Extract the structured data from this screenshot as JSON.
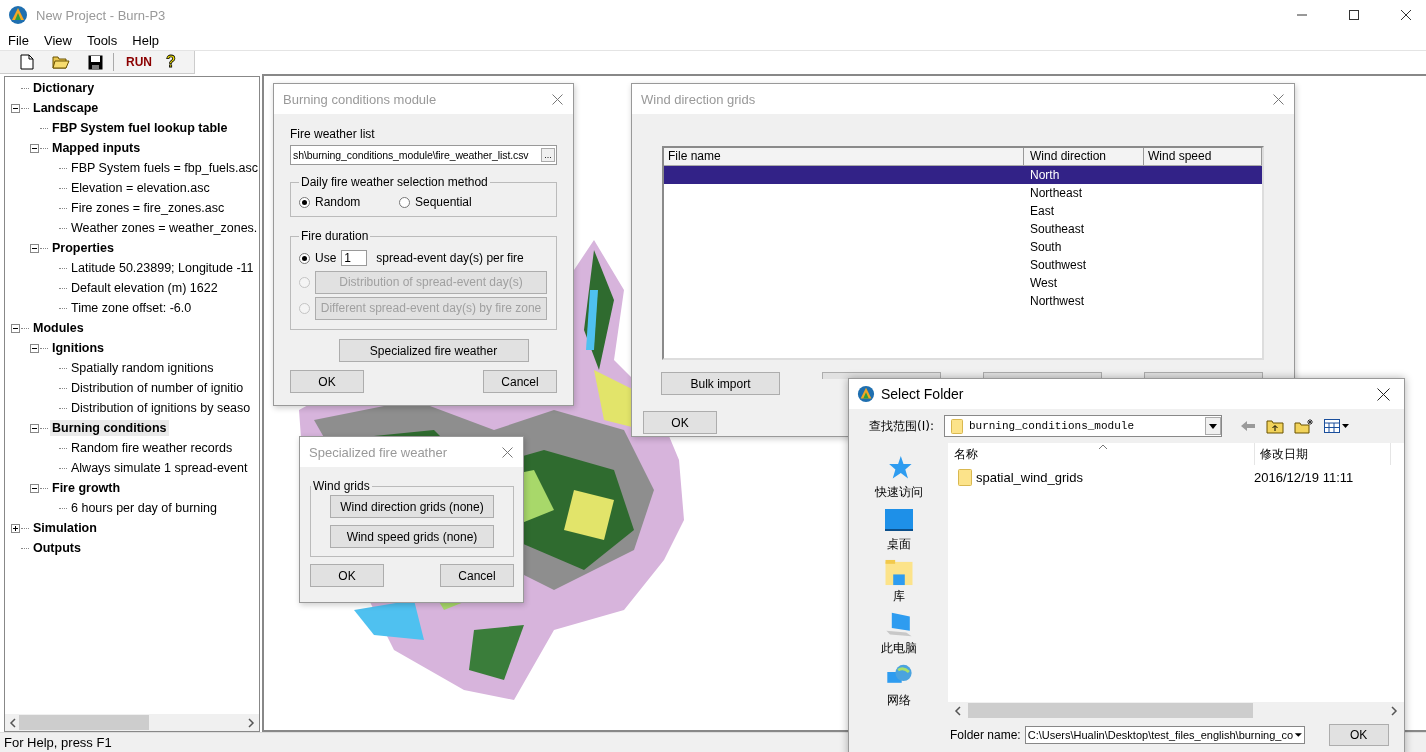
{
  "window": {
    "title": "New Project - Burn-P3"
  },
  "menu": [
    "File",
    "View",
    "Tools",
    "Help"
  ],
  "toolbar": [
    {
      "kind": "new"
    },
    {
      "kind": "open"
    },
    {
      "kind": "save"
    },
    {
      "kind": "run",
      "label": "RUN"
    },
    {
      "kind": "help",
      "label": "?"
    }
  ],
  "tree": [
    {
      "label": "Dictionary",
      "selected": false
    },
    {
      "label": "Landscape",
      "selected": false,
      "expanded": true,
      "children": [
        {
          "label": "FBP System fuel lookup table",
          "selected": false
        },
        {
          "label": "Mapped inputs",
          "selected": false,
          "expanded": true,
          "children": [
            {
              "label": "FBP System fuels = fbp_fuels.asc",
              "selected": false
            },
            {
              "label": "Elevation = elevation.asc",
              "selected": false
            },
            {
              "label": "Fire zones = fire_zones.asc",
              "selected": false
            },
            {
              "label": "Weather zones = weather_zones.",
              "selected": false
            }
          ]
        },
        {
          "label": "Properties",
          "selected": false,
          "expanded": true,
          "children": [
            {
              "label": "Latitude 50.23899; Longitude -11",
              "selected": false
            },
            {
              "label": "Default elevation (m) 1622",
              "selected": false
            },
            {
              "label": "Time zone offset: -6.0",
              "selected": false
            }
          ]
        }
      ]
    },
    {
      "label": "Modules",
      "selected": false,
      "expanded": true,
      "children": [
        {
          "label": "Ignitions",
          "selected": false,
          "expanded": true,
          "children": [
            {
              "label": "Spatially random ignitions",
              "selected": false
            },
            {
              "label": "Distribution of number of ignitio",
              "selected": false
            },
            {
              "label": "Distribution of ignitions by seaso",
              "selected": false
            }
          ]
        },
        {
          "label": "Burning conditions",
          "selected": true,
          "expanded": true,
          "children": [
            {
              "label": "Random fire weather records",
              "selected": false
            },
            {
              "label": "Always simulate 1 spread-event",
              "selected": false
            }
          ]
        },
        {
          "label": "Fire growth",
          "selected": false,
          "expanded": true,
          "children": [
            {
              "label": "6 hours per day of burning",
              "selected": false
            }
          ]
        }
      ]
    },
    {
      "label": "Simulation",
      "selected": false,
      "expanded": false
    },
    {
      "label": "Outputs",
      "selected": false
    }
  ],
  "map": {
    "kind": "picture"
  },
  "burning_dialog": {
    "title": "Burning conditions module",
    "fire_weather_list": {
      "label": "Fire weather list",
      "value": "sh\\burning_conditions_module\\fire_weather_list.csv",
      "button": "..."
    },
    "selection_method": {
      "label": "Daily fire weather selection method",
      "options": [
        {
          "label": "Random",
          "selected": true
        },
        {
          "label": "Sequential",
          "selected": false
        }
      ]
    },
    "fire_duration": {
      "label": "Fire duration",
      "options": [
        {
          "kind": "days",
          "prefix": "Use",
          "value": "1",
          "suffix": "spread-event day(s) per fire",
          "selected": true,
          "disabled": false
        },
        {
          "kind": "button",
          "label": "Distribution of spread-event day(s)",
          "selected": false,
          "disabled": true
        },
        {
          "kind": "button",
          "label": "Different spread-event day(s) by fire zone",
          "selected": false,
          "disabled": true
        }
      ]
    },
    "specialized_button": "Specialized fire weather",
    "ok": "OK",
    "cancel": "Cancel"
  },
  "wind_dialog": {
    "title": "Wind direction grids",
    "columns": [
      "File name",
      "Wind direction",
      "Wind speed"
    ],
    "rows": [
      {
        "wind_direction": "North",
        "selected": true
      },
      {
        "wind_direction": "Northeast",
        "selected": false
      },
      {
        "wind_direction": "East",
        "selected": false
      },
      {
        "wind_direction": "Southeast",
        "selected": false
      },
      {
        "wind_direction": "South",
        "selected": false
      },
      {
        "wind_direction": "Southwest",
        "selected": false
      },
      {
        "wind_direction": "West",
        "selected": false
      },
      {
        "wind_direction": "Northwest",
        "selected": false
      }
    ],
    "buttons": [
      {
        "kind": "button",
        "label": "Bulk import"
      },
      {
        "kind": "covered"
      },
      {
        "kind": "covered"
      },
      {
        "kind": "covered"
      }
    ],
    "ok": "OK"
  },
  "specialized_dialog": {
    "title": "Specialized fire weather",
    "group": "Wind grids",
    "buttons": [
      "Wind direction grids (none)",
      "Wind speed grids (none)"
    ],
    "ok": "OK",
    "cancel": "Cancel"
  },
  "folder_dialog": {
    "title": "Select Folder",
    "look_in_label": "查找范围(I):",
    "look_in_value": "burning_conditions_module",
    "places": [
      {
        "kind": "quick-access",
        "label": "快速访问"
      },
      {
        "kind": "desktop",
        "label": "桌面"
      },
      {
        "kind": "library",
        "label": "库"
      },
      {
        "kind": "computer",
        "label": "此电脑"
      },
      {
        "kind": "network",
        "label": "网络"
      }
    ],
    "columns": [
      "名称",
      "修改日期"
    ],
    "files": [
      {
        "name": "spatial_wind_grids",
        "modified": "2016/12/19 11:11"
      }
    ],
    "folder_name_label": "Folder name:",
    "folder_name_value": "C:\\Users\\Hualin\\Desktop\\test_files_english\\burning_co",
    "ok": "OK"
  },
  "status_bar": "For Help, press F1"
}
